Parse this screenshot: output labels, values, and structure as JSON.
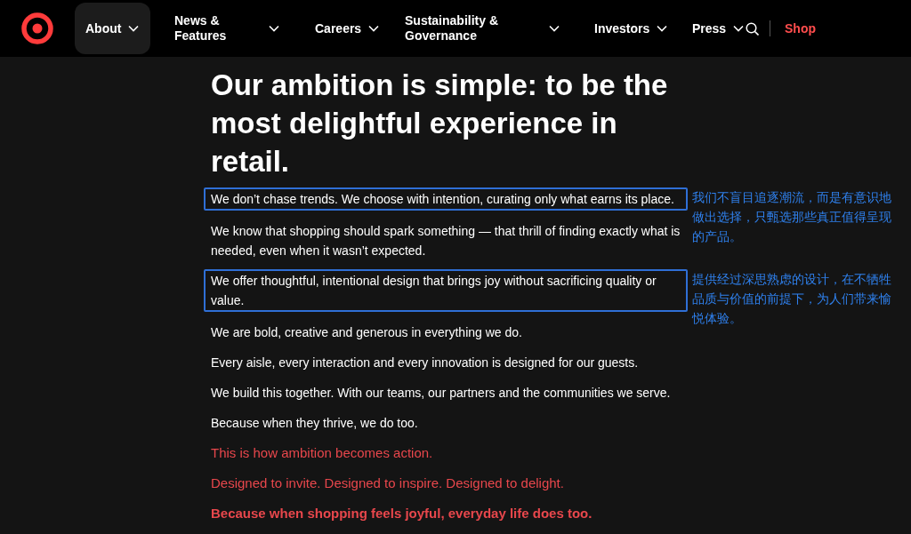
{
  "nav": {
    "items": [
      {
        "label": "About",
        "selected": true
      },
      {
        "label": "News & Features",
        "selected": false
      },
      {
        "label": "Careers",
        "selected": false
      },
      {
        "label": "Sustainability & Governance",
        "selected": false
      },
      {
        "label": "Investors",
        "selected": false
      },
      {
        "label": "Press",
        "selected": false
      }
    ],
    "shop": "Shop"
  },
  "heading": "Our ambition is simple: to be the most delightful experience in retail.",
  "paragraphs": [
    {
      "kind": "body",
      "text": "We don’t chase trends. We choose with intention, curating only what earns its place.",
      "highlighted": true,
      "note": "我们不盲目追逐潮流，而是有意识地做出选择，只甄选那些真正值得呈现的产品。"
    },
    {
      "kind": "body",
      "text": "We know that shopping should spark something — that thrill of finding exactly what is needed, even when it wasn’t expected.",
      "highlighted": false
    },
    {
      "kind": "body",
      "text": "We offer thoughtful, intentional design that brings joy without sacrificing quality or value.",
      "highlighted": true,
      "note": "提供经过深思熟虑的设计，在不牺牲品质与价值的前提下，为人们带来愉悦体验。"
    },
    {
      "kind": "body",
      "text": "We are bold, creative and generous in everything we do.",
      "highlighted": false
    },
    {
      "kind": "body",
      "text": "Every aisle, every interaction and every innovation is designed for our guests.",
      "highlighted": false
    },
    {
      "kind": "body",
      "text": "We build this together. With our teams, our partners and the communities we serve.",
      "highlighted": false
    },
    {
      "kind": "body",
      "text": "Because when they thrive, we do too.",
      "highlighted": false
    },
    {
      "kind": "accent",
      "text": "This is how ambition becomes action.",
      "highlighted": false
    },
    {
      "kind": "accent",
      "text": "Designed to invite. Designed to inspire. Designed to delight.",
      "highlighted": false
    },
    {
      "kind": "accent-bold",
      "text": "Because when shopping feels joyful, everyday life does too.",
      "highlighted": false
    }
  ]
}
